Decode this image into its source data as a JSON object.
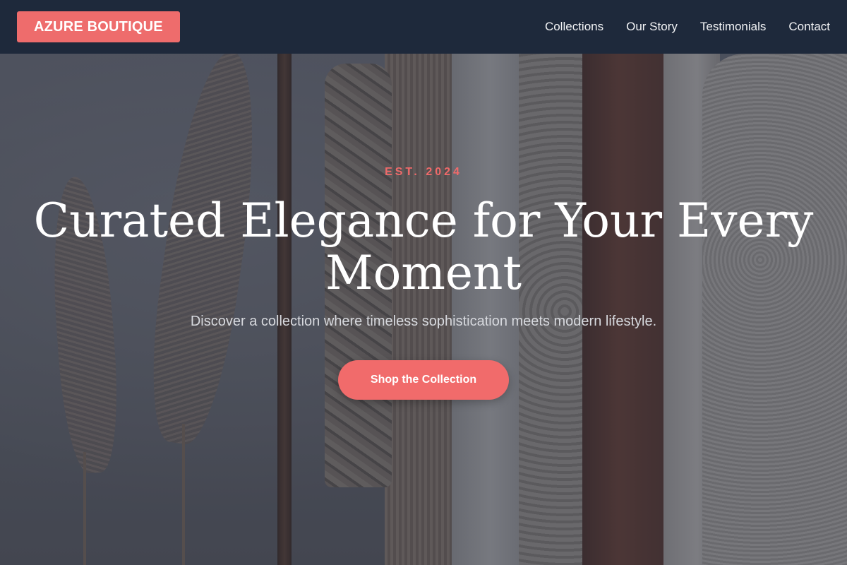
{
  "brand": {
    "name": "AZURE BOUTIQUE"
  },
  "nav": {
    "links": [
      {
        "label": "Collections"
      },
      {
        "label": "Our Story"
      },
      {
        "label": "Testimonials"
      },
      {
        "label": "Contact"
      }
    ]
  },
  "hero": {
    "eyebrow": "EST. 2024",
    "headline": "Curated Elegance for Your Every Moment",
    "subheadline": "Discover a collection where timeless sophistication meets modern lifestyle.",
    "cta_label": "Shop the Collection",
    "background_image": "clothing-rack-photo"
  },
  "colors": {
    "accent": "#ee6c6c",
    "nav_bg": "#1e293b",
    "headline": "#ffffff",
    "subheadline": "#d7d9de"
  }
}
